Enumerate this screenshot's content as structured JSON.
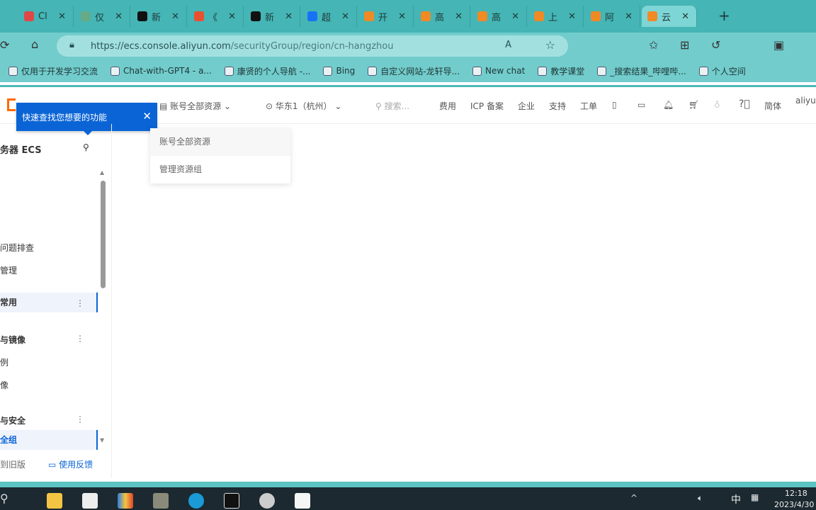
{
  "browser": {
    "tabs": [
      {
        "label": "Cl",
        "color": "#e04848"
      },
      {
        "label": "仅",
        "color": "#6a8"
      },
      {
        "label": "新",
        "color": "#111"
      },
      {
        "label": "《",
        "color": "#e8502f"
      },
      {
        "label": "新",
        "color": "#111"
      },
      {
        "label": "超",
        "color": "#1772f6"
      },
      {
        "label": "开",
        "color": "#f08a24"
      },
      {
        "label": "高",
        "color": "#f08a24"
      },
      {
        "label": "高",
        "color": "#f08a24"
      },
      {
        "label": "上",
        "color": "#f08a24"
      },
      {
        "label": "阿",
        "color": "#f08a24"
      },
      {
        "label": "云",
        "color": "#f08a24",
        "active": true
      }
    ],
    "close_glyph": "✕",
    "new_tab": "+",
    "url_host": "https://ecs.console.aliyun.com",
    "url_path": "/securityGroup/region/cn-hangzhou",
    "bookmarks": [
      "仅用于开发学习交流",
      "Chat-with-GPT4 - a...",
      "康贤的个人导航 -...",
      "Bing",
      "自定义网站-龙轩导...",
      "New chat",
      "教学课堂",
      "_搜索结果_哔哩哔...",
      "个人空间"
    ]
  },
  "console": {
    "resource_selector": "账号全部资源",
    "region_selector": "华东1（杭州）",
    "search_placeholder": "搜索...",
    "nav_links": [
      "费用",
      "ICP 备案",
      "企业",
      "支持",
      "工单"
    ],
    "language": "简体",
    "account": "aliyun",
    "tooltip": "快速查找您想要的功能",
    "dropdown_items": [
      "账号全部资源",
      "管理资源组"
    ],
    "sidebar": {
      "title": "务器 ECS",
      "items": [
        {
          "label": "问题排查"
        },
        {
          "label": "管理"
        },
        {
          "label": "常用",
          "bold": true,
          "selected": true,
          "menu": true
        },
        {
          "label": "与镜像",
          "bold": true,
          "menu": true
        },
        {
          "label": "例"
        },
        {
          "label": "像"
        },
        {
          "label": "与安全",
          "bold": true,
          "menu": true
        },
        {
          "label": "全组",
          "bold": true,
          "selected": true,
          "blue": true
        }
      ],
      "old_version": "到旧版",
      "feedback": "使用反馈"
    }
  },
  "taskbar": {
    "time": "12:18",
    "date": "2023/4/30",
    "ime": "中"
  }
}
